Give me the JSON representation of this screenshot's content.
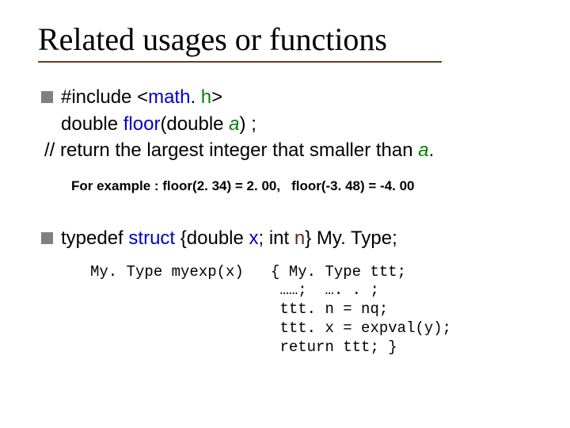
{
  "title": "Related usages or functions",
  "b1": {
    "prefix": "#include <",
    "math": "math",
    "dot": ". ",
    "h": "h",
    "suffix": ">"
  },
  "line2": {
    "t1": "double ",
    "floor": "floor",
    "t2": "(double ",
    "a": "a",
    "t3": ") ;"
  },
  "line3": {
    "t1": "// return the largest integer that smaller than ",
    "a": "a",
    "t2": "."
  },
  "example": {
    "lead": "For example : ",
    "ex1": "floor(2. 34) = 2. 00",
    "comma": ",",
    "ex2": "floor(-3. 48) = -4. 00"
  },
  "b2": {
    "t1": "typedef ",
    "struct": "struct",
    "t2": " {double ",
    "x": "x",
    "t3": "; int ",
    "n": "n",
    "t4": "} My. Type;"
  },
  "code": "My. Type myexp(x)   { My. Type ttt;\n                     ……;  …. . ;\n                     ttt. n = nq;\n                     ttt. x = expval(y);\n                     return ttt; }"
}
